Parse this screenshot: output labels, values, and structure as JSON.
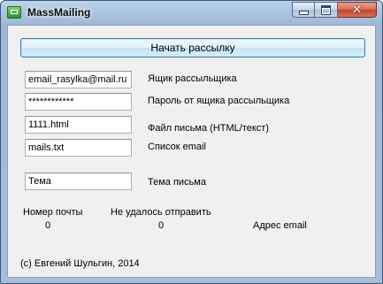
{
  "window": {
    "title": "MassMailing",
    "minimize_icon": "minimize-icon",
    "maximize_icon": "maximize-icon",
    "close_icon": "close-icon",
    "close_glyph": "✕"
  },
  "actions": {
    "start_label": "Начать рассылку"
  },
  "form": {
    "mailbox": {
      "value": "email_rasylka@mail.ru",
      "label": "Ящик рассыльщика"
    },
    "password": {
      "value": "************",
      "label": "Пароль от ящика рассыльщика"
    },
    "letter_file": {
      "value": "1111.html",
      "label": "Файл письма (HTML/текст)"
    },
    "email_list": {
      "value": "mails.txt",
      "label": "Список email"
    },
    "subject": {
      "value": "Тема",
      "label": "Тема письма"
    }
  },
  "status": {
    "mail_number_label": "Номер почты",
    "mail_number_value": "0",
    "failed_label": "Не удалось отправить",
    "failed_value": "0",
    "address_label": "Адрес email"
  },
  "footer": {
    "copyright": "(c) Евгений Шульгин, 2014"
  },
  "colors": {
    "titlebar": "#a9c3df",
    "client_bg": "#f0f0f0",
    "button_border": "#3c7fb1",
    "close_button": "#c4452c"
  }
}
